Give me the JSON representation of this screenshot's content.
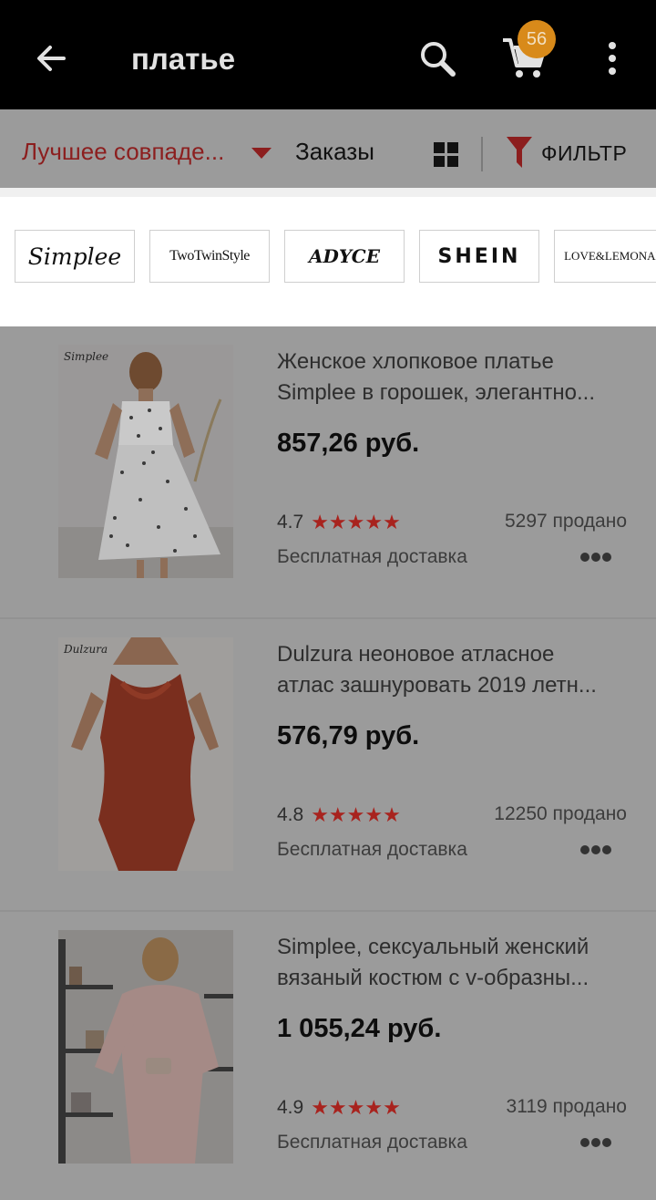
{
  "header": {
    "title": "платье",
    "cart_count": "56"
  },
  "sort": {
    "best_match": "Лучшее совпаде...",
    "orders": "Заказы",
    "filter": "ФИЛЬТР"
  },
  "brands": [
    {
      "name": "Simplee"
    },
    {
      "name": "TwoTwinStyle"
    },
    {
      "name": "ADYCE"
    },
    {
      "name": "SHEIN"
    },
    {
      "name": "LOVE&LEMONAD"
    }
  ],
  "products": [
    {
      "title_line1": "Женское хлопковое платье",
      "title_line2": "Simplee в горошек, элегантно...",
      "price": "857,26 руб.",
      "rating": "4.7",
      "stars": "★★★★★",
      "sold": "5297 продано",
      "shipping": "Бесплатная доставка",
      "brand_mark": "Simplee"
    },
    {
      "title_line1": "Dulzura неоновое атласное",
      "title_line2": "атлас зашнуровать 2019 летн...",
      "price": "576,79 руб.",
      "rating": "4.8",
      "stars": "★★★★★",
      "sold": "12250 продано",
      "shipping": "Бесплатная доставка",
      "brand_mark": "Dulzura"
    },
    {
      "title_line1": "Simplee, сексуальный женский",
      "title_line2": "вязаный костюм с v-образны...",
      "price": "1 055,24 руб.",
      "rating": "4.9",
      "stars": "★★★★★",
      "sold": "3119 продано",
      "shipping": "Бесплатная доставка",
      "brand_mark": ""
    }
  ],
  "colors": {
    "accent_red": "#8c1e1e",
    "star_red": "#a8231e",
    "badge_orange": "#d88a1a",
    "overlay_gray": "#9b9b9b"
  },
  "icons": [
    "back-arrow-icon",
    "search-icon",
    "cart-icon",
    "more-vertical-icon",
    "caret-down-icon",
    "grid-view-icon",
    "filter-funnel-icon",
    "more-horizontal-icon"
  ]
}
